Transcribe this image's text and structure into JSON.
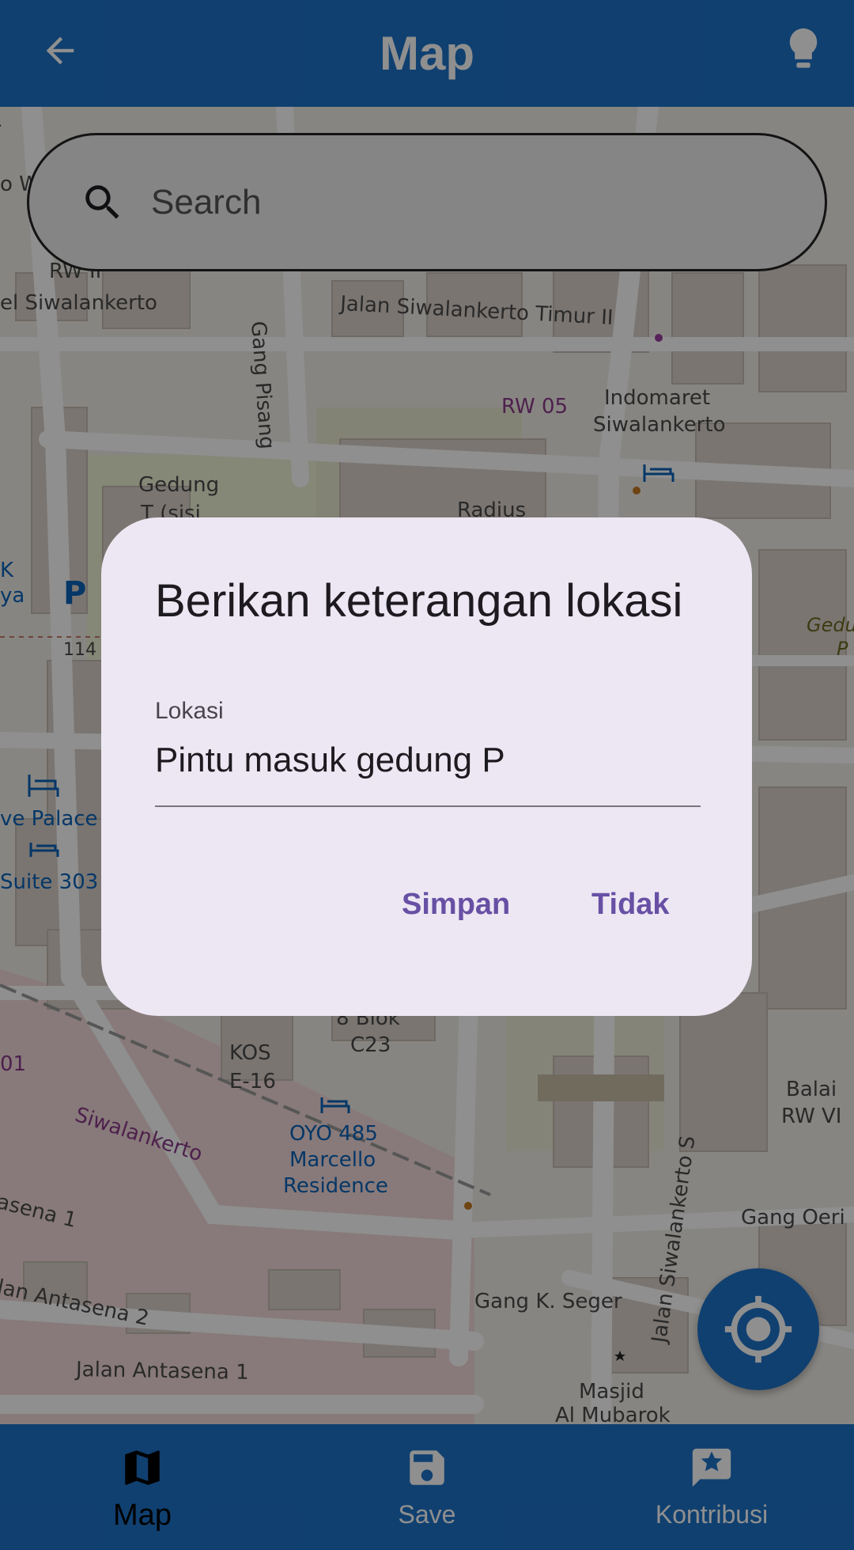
{
  "appbar": {
    "title": "Map",
    "back_icon": "arrow-back-icon",
    "hint_icon": "lightbulb-icon"
  },
  "search": {
    "placeholder": "Search",
    "icon": "search-icon"
  },
  "map": {
    "labels": [
      "RW II",
      "el Siwalankerto",
      "Gang Pisang",
      "Jalan Siwalankerto Timur II",
      "RW 05",
      "Indomaret",
      "Siwalankerto",
      "Gedung",
      "T (sisi",
      "Radius",
      "K",
      "ya",
      "P",
      "114",
      "Gedu",
      "P",
      "ve Palace",
      "Suite 303",
      "8 Blok",
      "C23",
      "KOS",
      "E-16",
      "Siwalankerto",
      "OYO 485",
      "Marcello",
      "Residence",
      "asena 1",
      "Jalan Siwalankerto S",
      "Balai",
      "RW VI",
      "Gang Oeri",
      "lan Antasena 2",
      "Jalan Antasena 1",
      "Gang K. Seger",
      "Masjid",
      "Al Mubarok",
      "01",
      "W",
      "o W"
    ]
  },
  "dialog": {
    "title": "Berikan keterangan lokasi",
    "field_label": "Lokasi",
    "field_value": "Pintu masuk gedung P",
    "save_label": "Simpan",
    "cancel_label": "Tidak"
  },
  "fab": {
    "icon": "my-location-icon"
  },
  "bottom_nav": {
    "items": [
      {
        "label": "Map",
        "icon": "map-icon",
        "active": true
      },
      {
        "label": "Save",
        "icon": "save-icon",
        "active": false
      },
      {
        "label": "Kontribusi",
        "icon": "contribute-icon",
        "active": false
      }
    ]
  },
  "colors": {
    "primary": "#1e73c8",
    "dialog_bg": "#ede7f3",
    "dialog_button": "#6750a4",
    "scrim": "rgba(0,0,0,0.44)"
  }
}
